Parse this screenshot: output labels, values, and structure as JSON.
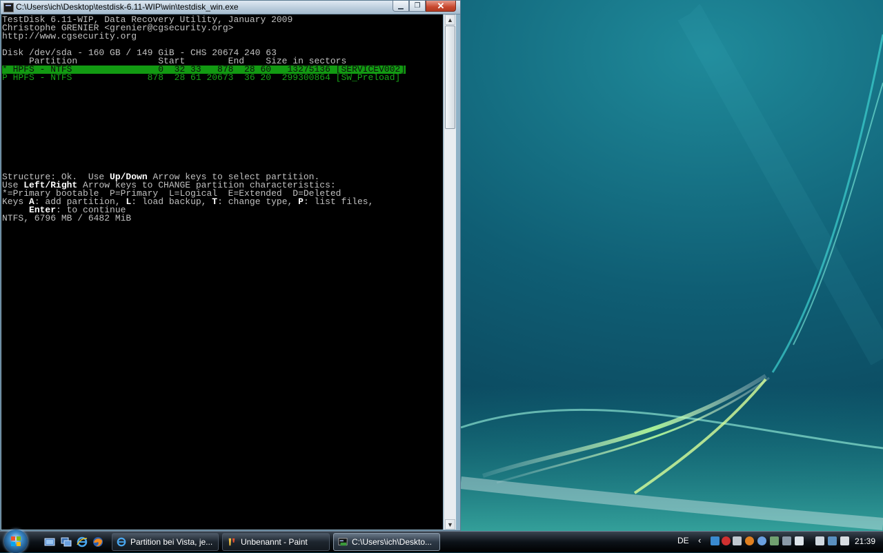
{
  "window": {
    "title": "C:\\Users\\ich\\Desktop\\testdisk-6.11-WIP\\win\\testdisk_win.exe",
    "close_glyph": "✕",
    "min_glyph": "▁",
    "max_glyph": "❐"
  },
  "terminal": {
    "header": [
      "TestDisk 6.11-WIP, Data Recovery Utility, January 2009",
      "Christophe GRENIER <grenier@cgsecurity.org>",
      "http://www.cgsecurity.org"
    ],
    "disk_line": "Disk /dev/sda - 160 GB / 149 GiB - CHS 20674 240 63",
    "columns_line": "     Partition               Start        End    Size in sectors",
    "partitions": [
      "* HPFS - NTFS                0  32 33   878  28 60   13275136 [SERVICEV002]",
      "P HPFS - NTFS              878  28 61 20673  36 20  299300864 [SW_Preload]"
    ],
    "help": {
      "l1_a": "Structure: Ok.  Use ",
      "l1_b": "Up/Down",
      "l1_c": " Arrow keys to select partition.",
      "l2_a": "Use ",
      "l2_b": "Left/Right",
      "l2_c": " Arrow keys to CHANGE partition characteristics:",
      "l3": "*=Primary bootable  P=Primary  L=Logical  E=Extended  D=Deleted",
      "l4_a": "Keys ",
      "l4_b": "A",
      "l4_c": ": add partition, ",
      "l4_d": "L",
      "l4_e": ": load backup, ",
      "l4_f": "T",
      "l4_g": ": change type, ",
      "l4_h": "P",
      "l4_i": ": list files,",
      "l5_a": "     ",
      "l5_b": "Enter",
      "l5_c": ": to continue"
    },
    "selected_info": "NTFS, 6796 MB / 6482 MiB"
  },
  "scrollbar": {
    "up_glyph": "▲",
    "down_glyph": "▼"
  },
  "taskbar": {
    "tasks": [
      {
        "label": "Partition bei Vista, je..."
      },
      {
        "label": "Unbenannt - Paint"
      },
      {
        "label": "C:\\Users\\ich\\Deskto..."
      }
    ],
    "language": "DE",
    "chevron": "‹",
    "clock": "21:39"
  },
  "colors": {
    "terminal_bg": "#000000",
    "selected_row": "#129a12",
    "partition_text": "#18a818"
  }
}
